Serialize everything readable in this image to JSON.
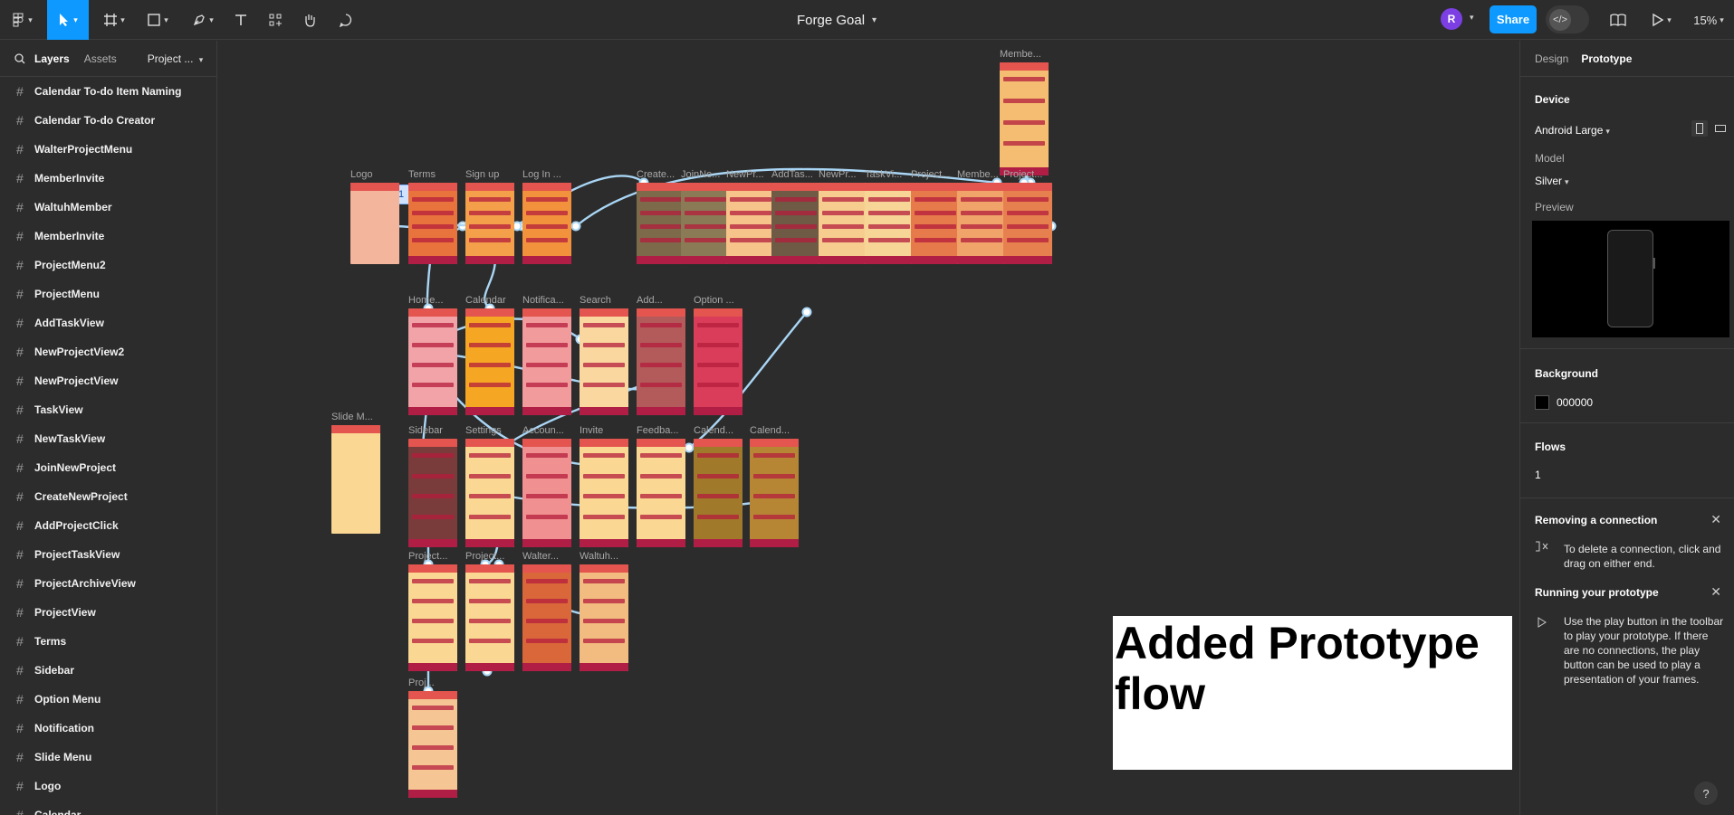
{
  "toolbar": {
    "doc_title": "Forge Goal",
    "share_label": "Share",
    "avatar_letter": "R",
    "zoom": "15%"
  },
  "left_panel": {
    "tabs": [
      "Layers",
      "Assets"
    ],
    "page": "Project ...",
    "layers": [
      "Calendar To-do Item Naming",
      "Calendar To-do Creator",
      "WalterProjectMenu",
      "MemberInvite",
      "WaltuhMember",
      "MemberInvite",
      "ProjectMenu2",
      "ProjectMenu",
      "AddTaskView",
      "NewProjectView2",
      "NewProjectView",
      "TaskView",
      "NewTaskView",
      "JoinNewProject",
      "CreateNewProject",
      "AddProjectClick",
      "ProjectTaskView",
      "ProjectArchiveView",
      "ProjectView",
      "Terms",
      "Sidebar",
      "Option Menu",
      "Notification",
      "Slide Menu",
      "Logo",
      "Calendar"
    ]
  },
  "canvas": {
    "flow_badge": "1",
    "note_text": "Added Prototype flow",
    "frame_labels": [
      "Membe...",
      "Logo",
      "Terms",
      "Sign up",
      "Log In ...",
      "Create...",
      "JoinNe...",
      "NewPr...",
      "AddTas...",
      "NewPr...",
      "TaskVi...",
      "Project...",
      "Membe...",
      "Project...",
      "Home...",
      "Calendar",
      "Notifica...",
      "Search",
      "Add...",
      "Option ...",
      "Slide M...",
      "Sidebar",
      "Settings",
      "Accoun...",
      "Invite",
      "Feedba...",
      "Calend...",
      "Calend...",
      "Project...",
      "Project...",
      "Walter...",
      "Waltuh...",
      "Proj..."
    ]
  },
  "right_panel": {
    "tabs": [
      "Design",
      "Prototype"
    ],
    "device_title": "Device",
    "device_value": "Android Large",
    "model_label": "Model",
    "model_value": "Silver",
    "preview_label": "Preview",
    "background_title": "Background",
    "background_value": "000000",
    "flows_title": "Flows",
    "flows_value": "1",
    "tip1_title": "Removing a connection",
    "tip1_text": "To delete a connection, click and drag on either end.",
    "tip2_title": "Running your prototype",
    "tip2_text": "Use the play button in the toolbar to play your prototype. If there are no connections, the play button can be used to play a presentation of your frames.",
    "help": "?"
  },
  "colors": {
    "accent": "#0d99ff",
    "connection": "#a9d6f5",
    "canvas": "#2c2c2c"
  }
}
